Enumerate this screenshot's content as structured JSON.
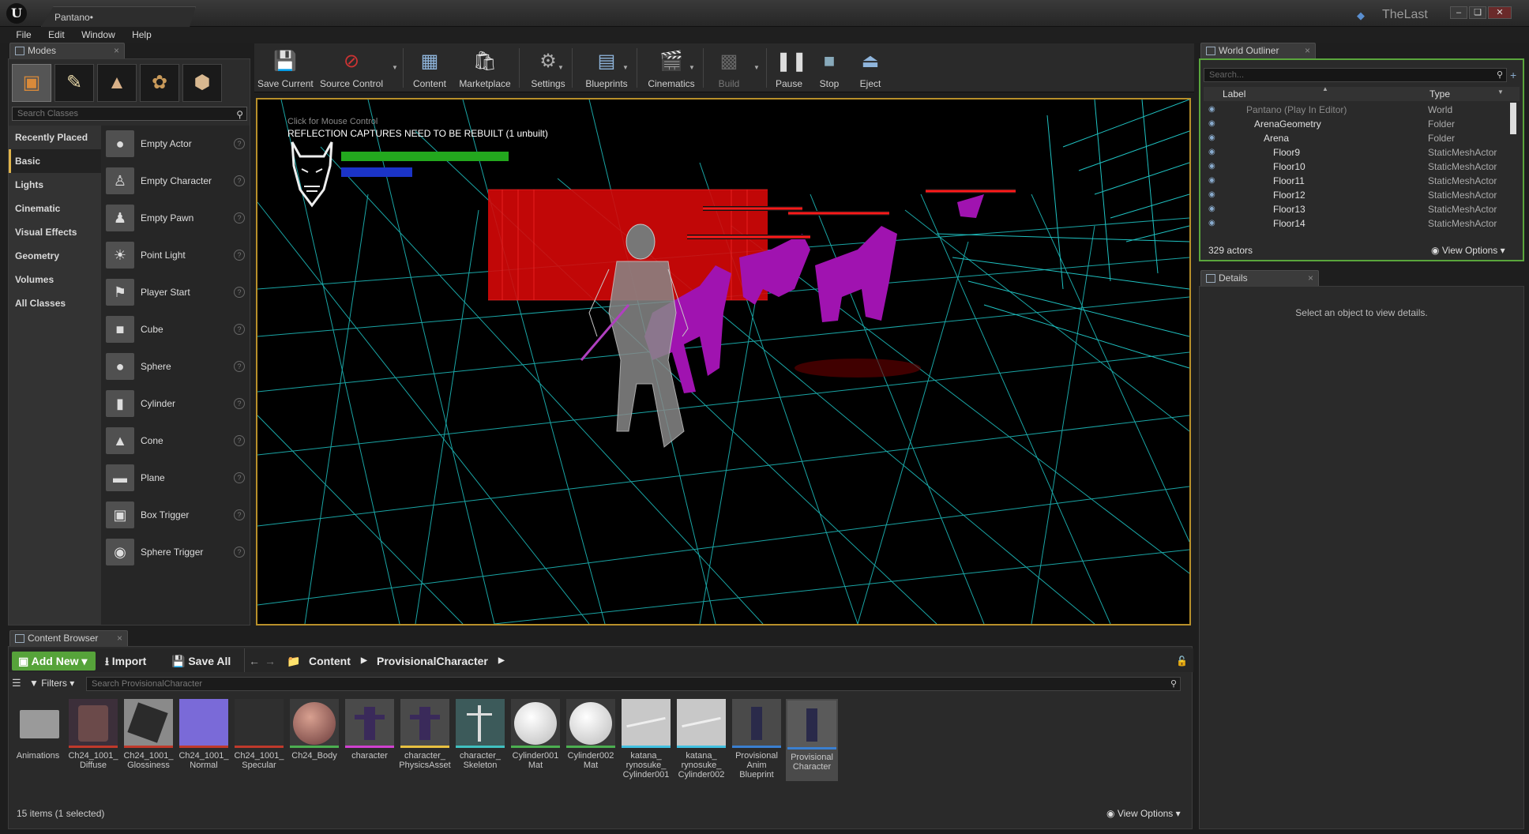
{
  "window": {
    "doc_tab": "Pantano•",
    "project": "TheLast"
  },
  "menu": [
    "File",
    "Edit",
    "Window",
    "Help"
  ],
  "modes": {
    "tab": "Modes",
    "search_placeholder": "Search Classes",
    "categories": [
      "Recently Placed",
      "Basic",
      "Lights",
      "Cinematic",
      "Visual Effects",
      "Geometry",
      "Volumes",
      "All Classes"
    ],
    "selected_category": "Basic",
    "items": [
      "Empty Actor",
      "Empty Character",
      "Empty Pawn",
      "Point Light",
      "Player Start",
      "Cube",
      "Sphere",
      "Cylinder",
      "Cone",
      "Plane",
      "Box Trigger",
      "Sphere Trigger"
    ]
  },
  "toolbar": {
    "save_current": "Save Current",
    "source_control": "Source Control",
    "content": "Content",
    "marketplace": "Marketplace",
    "settings": "Settings",
    "blueprints": "Blueprints",
    "cinematics": "Cinematics",
    "build": "Build",
    "pause": "Pause",
    "stop": "Stop",
    "eject": "Eject"
  },
  "viewport": {
    "hint": "Click for Mouse Control",
    "warning": "REFLECTION CAPTURES NEED TO BE REBUILT (1 unbuilt)",
    "health_fraction": 0.78,
    "stamina_fraction": 0.33
  },
  "outliner": {
    "tab": "World Outliner",
    "search_placeholder": "Search...",
    "col_label": "Label",
    "col_type": "Type",
    "rows": [
      {
        "label": "Pantano (Play In Editor)",
        "type": "World"
      },
      {
        "label": "ArenaGeometry",
        "type": "Folder"
      },
      {
        "label": "Arena",
        "type": "Folder"
      },
      {
        "label": "Floor9",
        "type": "StaticMeshActor"
      },
      {
        "label": "Floor10",
        "type": "StaticMeshActor"
      },
      {
        "label": "Floor11",
        "type": "StaticMeshActor"
      },
      {
        "label": "Floor12",
        "type": "StaticMeshActor"
      },
      {
        "label": "Floor13",
        "type": "StaticMeshActor"
      },
      {
        "label": "Floor14",
        "type": "StaticMeshActor"
      }
    ],
    "count": "329 actors",
    "view_options": "View Options"
  },
  "details": {
    "tab": "Details",
    "message": "Select an object to view details."
  },
  "content_browser": {
    "tab": "Content Browser",
    "add_new": "Add New",
    "import": "Import",
    "save_all": "Save All",
    "path": [
      "Content",
      "ProvisionalCharacter"
    ],
    "filters": "Filters",
    "search_placeholder": "Search ProvisionalCharacter",
    "assets": [
      "Animations",
      "Ch24_1001_\nDiffuse",
      "Ch24_1001_\nGlossiness",
      "Ch24_1001_\nNormal",
      "Ch24_1001_\nSpecular",
      "Ch24_Body",
      "character",
      "character_\nPhysicsAsset",
      "character_\nSkeleton",
      "Cylinder001\nMat",
      "Cylinder002\nMat",
      "katana_\nrynosuke_\nCylinder001",
      "katana_\nrynosuke_\nCylinder002",
      "Provisional\nAnim\nBlueprint",
      "Provisional\nCharacter"
    ],
    "status": "15 items (1 selected)",
    "view_options": "View Options"
  },
  "colors": {
    "accent_green": "#56a33a",
    "viewport_border": "#b8902a",
    "wire_cyan": "#1fc2c2",
    "wire_red": "#e01010",
    "wolf_purple": "#a013b0"
  }
}
